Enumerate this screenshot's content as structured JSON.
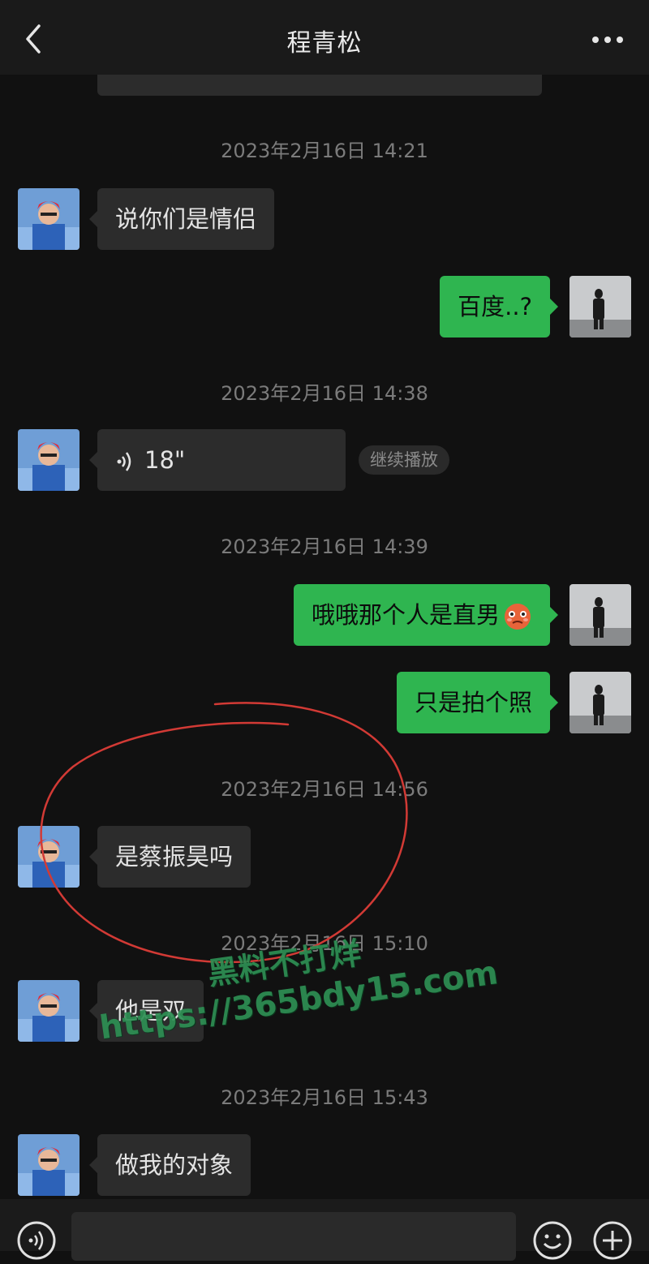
{
  "header": {
    "title": "程青松",
    "back_icon": "chevron-left-icon",
    "more_icon": "more-dots-icon"
  },
  "messages": [
    {
      "type": "timestamp",
      "text": "2023年2月16日 14:21"
    },
    {
      "type": "incoming",
      "text": "说你们是情侣"
    },
    {
      "type": "outgoing",
      "text": "百度..?"
    },
    {
      "type": "timestamp",
      "text": "2023年2月16日 14:38"
    },
    {
      "type": "incoming-voice",
      "duration": "18\"",
      "action": "继续播放"
    },
    {
      "type": "timestamp",
      "text": "2023年2月16日 14:39"
    },
    {
      "type": "outgoing",
      "text": "哦哦那个人是直男",
      "emoji": "flushed-face-emoji"
    },
    {
      "type": "outgoing",
      "text": "只是拍个照"
    },
    {
      "type": "timestamp",
      "text": "2023年2月16日 14:56"
    },
    {
      "type": "incoming",
      "text": "是蔡振昊吗"
    },
    {
      "type": "timestamp",
      "text": "2023年2月16日 15:10"
    },
    {
      "type": "incoming",
      "text": "他是双"
    },
    {
      "type": "timestamp",
      "text": "2023年2月16日 15:43"
    },
    {
      "type": "incoming",
      "text": "做我的对象"
    }
  ],
  "watermark": {
    "line1": "黑料不打烊",
    "line2": "https://365bdy15.com",
    "color": "#2e8f54"
  },
  "annotation": {
    "type": "hand-drawn circle",
    "color": "#d23a35"
  },
  "input_bar": {
    "voice_icon": "voice-input-icon",
    "emoji_icon": "emoji-icon",
    "plus_icon": "plus-icon"
  },
  "colors": {
    "outgoing_bubble": "#2fb550",
    "incoming_bubble": "#2c2c2c",
    "background": "#111111"
  }
}
